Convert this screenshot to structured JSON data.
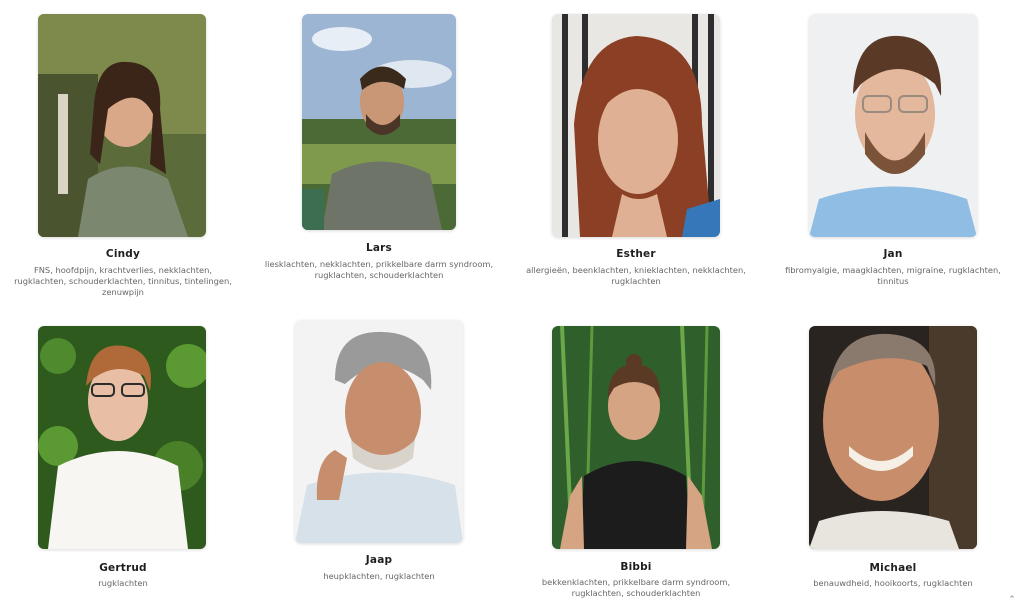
{
  "team": [
    {
      "name": "Cindy",
      "tags": "FNS, hoofdpijn, krachtverlies, nekklachten, rugklachten, schouderklachten, tinnitus, tintelingen, zenuwpijn"
    },
    {
      "name": "Lars",
      "tags": "liesklachten, nekklachten, prikkelbare darm syndroom, rugklachten, schouderklachten"
    },
    {
      "name": "Esther",
      "tags": "allergieën, beenklachten, knieklachten, nekklachten, rugklachten"
    },
    {
      "name": "Jan",
      "tags": "fibromyalgie, maagklachten, migraine, rugklachten, tinnitus"
    },
    {
      "name": "Gertrud",
      "tags": "rugklachten"
    },
    {
      "name": "Jaap",
      "tags": "heupklachten, rugklachten"
    },
    {
      "name": "Bibbi",
      "tags": "bekkenklachten, prikkelbare darm syndroom, rugklachten, schouderklachten"
    },
    {
      "name": "Michael",
      "tags": "benauwdheid, hooikoorts, rugklachten"
    }
  ],
  "scroll_icon": "chevron-up-icon"
}
